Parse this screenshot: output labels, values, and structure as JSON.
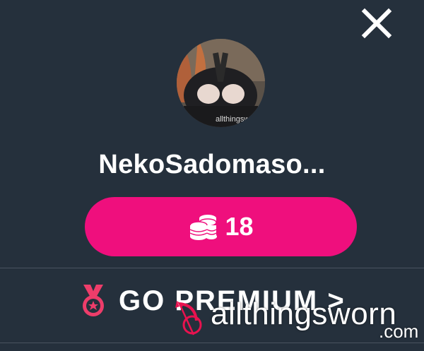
{
  "close_icon": "close-icon",
  "profile": {
    "username": "NekoSadomaso...",
    "avatar_watermark": "allthingsworn"
  },
  "coins": {
    "icon": "coins-icon",
    "count": "18",
    "button_color": "#ef0f7d"
  },
  "premium": {
    "icon": "medal-icon",
    "label": "GO PREMIUM >"
  },
  "watermark": {
    "icon": "bow-arrow-icon",
    "text": "allthingsworn",
    "suffix": ".com"
  },
  "colors": {
    "background": "#25303c",
    "accent": "#ef0f7d",
    "divider": "#4a5360"
  }
}
